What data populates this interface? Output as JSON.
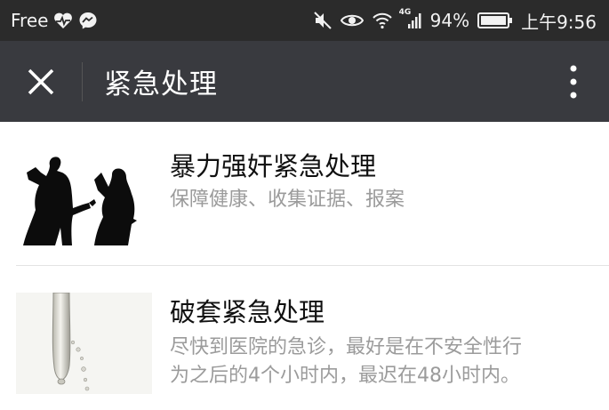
{
  "status_bar": {
    "carrier": "Free",
    "network": "4G",
    "battery": "94%",
    "time": "上午9:56",
    "icons": [
      "heartbeat-icon",
      "messenger-icon",
      "mute-icon",
      "eye-icon",
      "wifi-icon",
      "signal-icon",
      "battery-icon"
    ]
  },
  "navbar": {
    "title": "紧急处理",
    "close_icon": "close-icon",
    "more_icon": "more-vertical-icon"
  },
  "items": [
    {
      "title": "暴力强奸紧急处理",
      "description": "保障健康、收集证据、报案",
      "image": "violence-silhouette-image"
    },
    {
      "title": "破套紧急处理",
      "description_line1": "尽快到医院的急诊，最好是在不安全性行",
      "description_line2": "为之后的4个小时内，最迟在48小时内。",
      "image": "broken-condom-image"
    }
  ],
  "colors": {
    "status_bar_bg": "#2b2b2b",
    "navbar_bg": "#393a3f",
    "title_text": "#111111",
    "desc_text": "#9b9b9b"
  }
}
